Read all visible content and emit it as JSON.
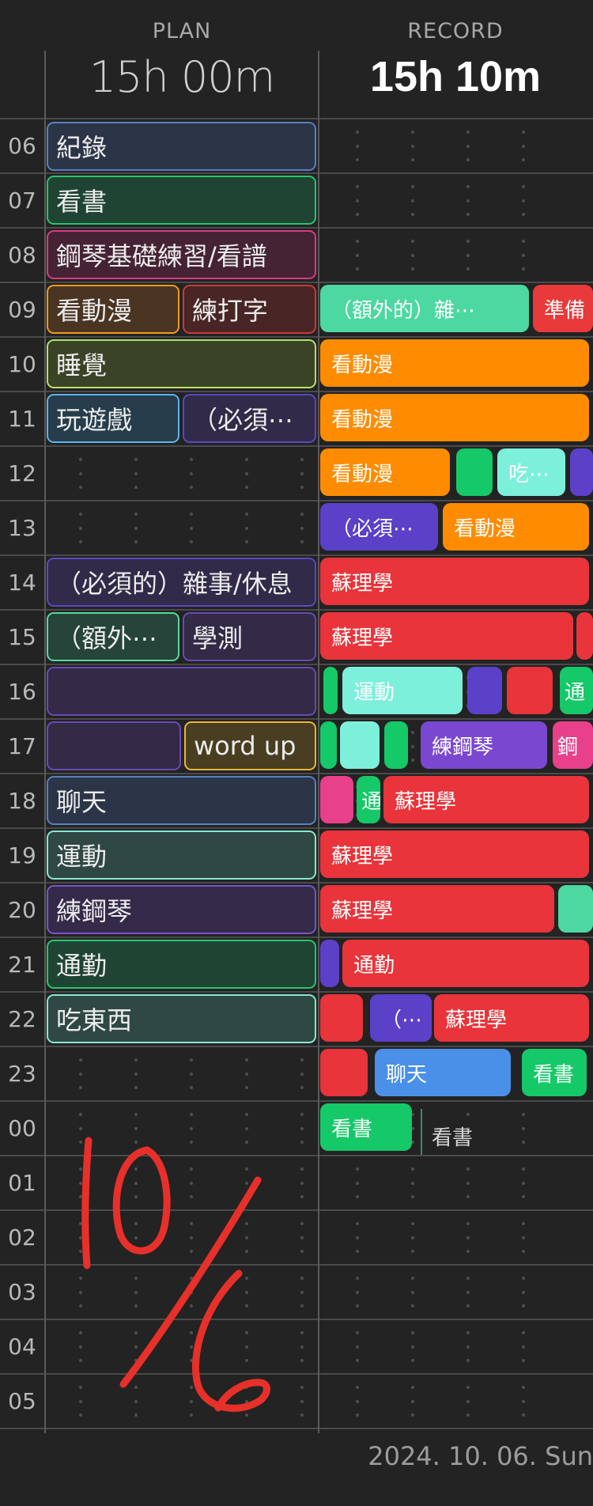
{
  "header": {
    "plan_label": "PLAN",
    "record_label": "RECORD",
    "plan_total": "15h 00m",
    "record_total": "15h 10m"
  },
  "hours": [
    "06",
    "07",
    "08",
    "09",
    "10",
    "11",
    "12",
    "13",
    "14",
    "15",
    "16",
    "17",
    "18",
    "19",
    "20",
    "21",
    "22",
    "23",
    "00",
    "01",
    "02",
    "03",
    "04",
    "05"
  ],
  "plan_blocks": [
    {
      "label": "紀錄",
      "color": "#5a7fc0",
      "fill": "#2c3548"
    },
    {
      "label": "看書",
      "color": "#29c46e",
      "fill": "#1f4433"
    },
    {
      "label": "鋼琴基礎練習/看譜",
      "color": "#d83a82",
      "fill": "#452334"
    },
    {
      "label": "看動漫",
      "color": "#f39a16",
      "fill": "#4a3522"
    },
    {
      "label": "練打字",
      "color": "#c83a3a",
      "fill": "#4a2525"
    },
    {
      "label": "睡覺",
      "color": "#b4e06a",
      "fill": "#3b4326"
    },
    {
      "label": "玩遊戲",
      "color": "#5ab4ea",
      "fill": "#273d4c"
    },
    {
      "label": "（必須⋯",
      "color": "#5b48c0",
      "fill": "#312a48"
    },
    {
      "label": "（必須的）雜事/休息",
      "color": "#5b48c0",
      "fill": "#312a48"
    },
    {
      "label": "（額外⋯",
      "color": "#58d8a0",
      "fill": "#27443a"
    },
    {
      "label": "學測",
      "color": "#6a48b8",
      "fill": "#332a46"
    },
    {
      "label": "",
      "color": "#6a48b8",
      "fill": "#332a46"
    },
    {
      "label": "",
      "color": "#6a48b8",
      "fill": "#332a46"
    },
    {
      "label": "word up",
      "color": "#e8b82e",
      "fill": "#4a3e22"
    },
    {
      "label": "聊天",
      "color": "#5a7fc0",
      "fill": "#2c3548"
    },
    {
      "label": "運動",
      "color": "#86e8d0",
      "fill": "#2f4844"
    },
    {
      "label": "練鋼琴",
      "color": "#7a52c8",
      "fill": "#352a4a"
    },
    {
      "label": "通勤",
      "color": "#29c46e",
      "fill": "#1f4433"
    },
    {
      "label": "吃東西",
      "color": "#86e8d0",
      "fill": "#2f4844"
    }
  ],
  "record_blocks": [
    {
      "label": "（額外的）雜⋯",
      "color": "#4cd8a0"
    },
    {
      "label": "準備",
      "color": "#e83a3a"
    },
    {
      "label": "看動漫",
      "color": "#ff8c00"
    },
    {
      "label": "看動漫",
      "color": "#ff8c00"
    },
    {
      "label": "看動漫",
      "color": "#ff8c00"
    },
    {
      "label": "",
      "color": "#15c868"
    },
    {
      "label": "吃⋯",
      "color": "#7df0dc"
    },
    {
      "label": "",
      "color": "#5b40c8"
    },
    {
      "label": "（必須⋯",
      "color": "#5b40c8"
    },
    {
      "label": "看動漫",
      "color": "#ff8c00"
    },
    {
      "label": "蘇理學",
      "color": "#e8343a"
    },
    {
      "label": "蘇理學",
      "color": "#e8343a"
    },
    {
      "label": "",
      "color": "#e8343a"
    },
    {
      "label": "",
      "color": "#15c868"
    },
    {
      "label": "運動",
      "color": "#7df0dc"
    },
    {
      "label": "",
      "color": "#5b40c8"
    },
    {
      "label": "",
      "color": "#e8343a"
    },
    {
      "label": "通",
      "color": "#15c868"
    },
    {
      "label": "",
      "color": "#15c868"
    },
    {
      "label": "",
      "color": "#7df0dc"
    },
    {
      "label": "",
      "color": "#15c868"
    },
    {
      "label": "練鋼琴",
      "color": "#7a48d0"
    },
    {
      "label": "鋼",
      "color": "#e8408a"
    },
    {
      "label": "",
      "color": "#e8408a"
    },
    {
      "label": "通",
      "color": "#15c868"
    },
    {
      "label": "蘇理學",
      "color": "#e8343a"
    },
    {
      "label": "蘇理學",
      "color": "#e8343a"
    },
    {
      "label": "蘇理學",
      "color": "#e8343a"
    },
    {
      "label": "",
      "color": "#4cd8a0"
    },
    {
      "label": "",
      "color": "#5b40c8"
    },
    {
      "label": "通勤",
      "color": "#e8343a"
    },
    {
      "label": "",
      "color": "#e8343a"
    },
    {
      "label": "（⋯",
      "color": "#5b40c8"
    },
    {
      "label": "蘇理學",
      "color": "#e8343a"
    },
    {
      "label": "",
      "color": "#e8343a"
    },
    {
      "label": "聊天",
      "color": "#4a90e8"
    },
    {
      "label": "看書",
      "color": "#15c868"
    },
    {
      "label": "看書",
      "color": "#15c868"
    }
  ],
  "record_trailing_text": "看書",
  "handwriting": {
    "text": "10/6",
    "color": "#e8302a"
  },
  "footer": {
    "date": "2024. 10. 06. Sun"
  }
}
